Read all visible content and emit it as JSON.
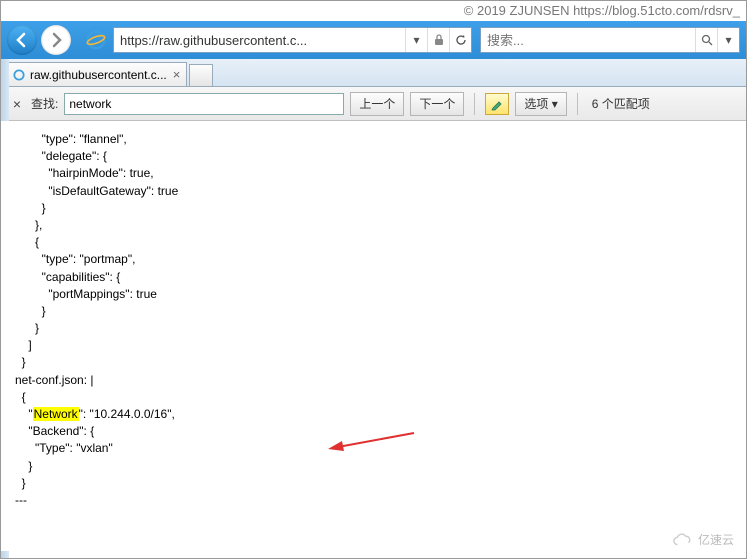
{
  "copyright": "© 2019 ZJUNSEN https://blog.51cto.com/rdsrv_",
  "nav": {
    "address": "https://raw.githubusercontent.c...",
    "search_placeholder": "搜索..."
  },
  "tab": {
    "title": "raw.githubusercontent.c..."
  },
  "findbar": {
    "close": "×",
    "label": "查找:",
    "value": "network",
    "prev": "上一个",
    "next": "下一个",
    "options": "选项",
    "count": "6 个匹配项"
  },
  "code": {
    "l1": "        \"type\": \"flannel\",",
    "l2": "        \"delegate\": {",
    "l3": "          \"hairpinMode\": true,",
    "l4": "          \"isDefaultGateway\": true",
    "l5": "        }",
    "l6": "      },",
    "l7": "      {",
    "l8": "        \"type\": \"portmap\",",
    "l9": "        \"capabilities\": {",
    "l10": "          \"portMappings\": true",
    "l11": "        }",
    "l12": "      }",
    "l13": "    ]",
    "l14": "  }",
    "l15": "net-conf.json: |",
    "l16": "  {",
    "l17a": "    \"",
    "l17b": "Network",
    "l17c": "\": \"10.244.0.0/16\",",
    "l18": "    \"Backend\": {",
    "l19": "      \"Type\": \"vxlan\"",
    "l20": "    }",
    "l21": "  }",
    "l22": "---"
  },
  "watermark": "亿速云"
}
